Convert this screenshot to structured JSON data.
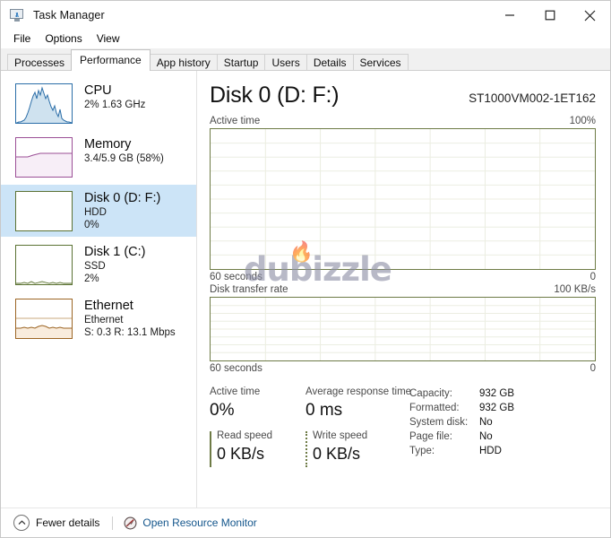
{
  "window": {
    "title": "Task Manager",
    "app_icon": "task-manager-icon",
    "controls": {
      "minimize": "minimize-icon",
      "maximize": "maximize-icon",
      "close": "close-icon"
    }
  },
  "menu": {
    "items": [
      "File",
      "Options",
      "View"
    ]
  },
  "tabs": {
    "active": "Performance",
    "items": [
      "Processes",
      "Performance",
      "App history",
      "Startup",
      "Users",
      "Details",
      "Services"
    ]
  },
  "sidebar": {
    "items": [
      {
        "name": "CPU",
        "line1": "CPU",
        "line2": "2%  1.63 GHz",
        "line3": "",
        "selected": false,
        "accent": "#2b6ea8"
      },
      {
        "name": "Memory",
        "line1": "Memory",
        "line2": "3.4/5.9 GB (58%)",
        "line3": "",
        "selected": false,
        "accent": "#9b4f96"
      },
      {
        "name": "Disk 0",
        "line1": "Disk 0 (D: F:)",
        "line2": "HDD",
        "line3": "0%",
        "selected": true,
        "accent": "#5b7233"
      },
      {
        "name": "Disk 1",
        "line1": "Disk 1 (C:)",
        "line2": "SSD",
        "line3": "2%",
        "selected": false,
        "accent": "#5b7233"
      },
      {
        "name": "Ethernet",
        "line1": "Ethernet",
        "line2": "Ethernet",
        "line3": "S: 0.3 R: 13.1 Mbps",
        "selected": false,
        "accent": "#9c6524"
      }
    ]
  },
  "main": {
    "title": "Disk 0 (D: F:)",
    "model": "ST1000VM002-1ET162",
    "active_graph": {
      "label": "Active time",
      "max": "100%",
      "x_left": "60 seconds",
      "x_right": "0"
    },
    "transfer_graph": {
      "label": "Disk transfer rate",
      "max": "100 KB/s",
      "x_left": "60 seconds",
      "x_right": "0"
    },
    "stats": {
      "active_time_label": "Active time",
      "active_time_value": "0%",
      "response_label": "Average response time",
      "response_value": "0 ms",
      "read_label": "Read speed",
      "read_value": "0 KB/s",
      "write_label": "Write speed",
      "write_value": "0 KB/s",
      "info": [
        {
          "key": "Capacity:",
          "value": "932 GB"
        },
        {
          "key": "Formatted:",
          "value": "932 GB"
        },
        {
          "key": "System disk:",
          "value": "No"
        },
        {
          "key": "Page file:",
          "value": "No"
        },
        {
          "key": "Type:",
          "value": "HDD"
        }
      ]
    }
  },
  "statusbar": {
    "fewer_details": "Fewer details",
    "fewer_details_pre": "F",
    "fewer_details_mid": "ewer ",
    "fewer_details_acc": "d",
    "fewer_details_post": "etails",
    "resource_monitor": "Open Resource Monitor",
    "resource_monitor_color": "#14568c"
  },
  "watermark": {
    "text": "dubizzle"
  },
  "chart_data": [
    {
      "type": "area",
      "title": "Active time",
      "ylabel": "",
      "xlabel": "60 seconds",
      "ylim": [
        0,
        100
      ],
      "y_max_label": "100%",
      "x_left_label": "60 seconds",
      "x_right_label": "0",
      "grid": true,
      "grid_rows": 10,
      "grid_cols": 6,
      "line_color": "#6e7b46",
      "fill_color": "#e8ebd9",
      "values": [
        0,
        0,
        0,
        0,
        0,
        0,
        0,
        0,
        0,
        0,
        0,
        0,
        0,
        0,
        0,
        0,
        0,
        0,
        0,
        0,
        0,
        0,
        0,
        0,
        0,
        0,
        0,
        0,
        0,
        0,
        0,
        0,
        0,
        0,
        0,
        0,
        0,
        0,
        0,
        0,
        0,
        0,
        0,
        0,
        0,
        0,
        0,
        0,
        0,
        0,
        0,
        0,
        0,
        0,
        0,
        0,
        0,
        0,
        0,
        0
      ]
    },
    {
      "type": "line",
      "title": "Disk transfer rate",
      "ylabel": "",
      "xlabel": "60 seconds",
      "ylim": [
        0,
        100
      ],
      "y_max_label": "100 KB/s",
      "x_left_label": "60 seconds",
      "x_right_label": "0",
      "grid": true,
      "grid_rows": 8,
      "grid_cols": 6,
      "line_color": "#6e7b46",
      "series": [
        {
          "name": "Read speed",
          "style": "solid",
          "values": [
            0,
            0,
            0,
            0,
            0,
            0,
            0,
            0,
            0,
            0,
            0,
            0,
            0,
            0,
            0,
            0,
            0,
            0,
            0,
            0,
            0,
            0,
            0,
            0,
            0,
            0,
            0,
            0,
            0,
            0,
            0,
            0,
            0,
            0,
            0,
            0,
            0,
            0,
            0,
            0,
            0,
            0,
            0,
            0,
            0,
            0,
            0,
            0,
            0,
            0,
            0,
            0,
            0,
            0,
            0,
            0,
            0,
            0,
            0,
            0
          ]
        },
        {
          "name": "Write speed",
          "style": "dotted",
          "values": [
            0,
            0,
            0,
            0,
            0,
            0,
            0,
            0,
            0,
            0,
            0,
            0,
            0,
            0,
            0,
            0,
            0,
            0,
            0,
            0,
            0,
            0,
            0,
            0,
            0,
            0,
            0,
            0,
            0,
            0,
            0,
            0,
            0,
            0,
            0,
            0,
            0,
            0,
            0,
            0,
            0,
            0,
            0,
            0,
            0,
            0,
            0,
            0,
            0,
            0,
            0,
            0,
            0,
            0,
            0,
            0,
            0,
            0,
            0,
            0
          ]
        }
      ]
    },
    {
      "type": "area",
      "title": "CPU thumbnail",
      "ylim": [
        0,
        100
      ],
      "line_color": "#2b6ea8",
      "fill_color": "#cfe2ef",
      "values": [
        2,
        2,
        3,
        2,
        4,
        3,
        5,
        8,
        14,
        26,
        38,
        52,
        64,
        58,
        70,
        62,
        78,
        66,
        54,
        62,
        48,
        36,
        28,
        34,
        22,
        16,
        30,
        14,
        9,
        6,
        5,
        4,
        3,
        3,
        2,
        2,
        2,
        2,
        2,
        2
      ]
    },
    {
      "type": "area",
      "title": "Memory thumbnail",
      "ylim": [
        0,
        100
      ],
      "line_color": "#9b4f96",
      "fill_color": "#f2e6f2",
      "values": [
        50,
        50,
        50,
        50,
        50,
        50,
        51,
        51,
        52,
        53,
        55,
        57,
        58,
        58,
        58,
        58,
        58,
        58,
        58,
        58,
        58,
        58,
        58,
        58,
        58,
        58,
        58,
        58,
        58,
        58,
        58,
        58,
        58,
        58,
        58,
        58,
        58,
        58,
        58,
        58
      ]
    },
    {
      "type": "area",
      "title": "Disk 0 thumbnail",
      "ylim": [
        0,
        100
      ],
      "line_color": "#5b7233",
      "fill_color": "#eef1e4",
      "values": [
        0,
        0,
        0,
        0,
        0,
        0,
        0,
        0,
        0,
        0,
        0,
        0,
        0,
        0,
        0,
        0,
        0,
        0,
        0,
        0,
        0,
        0,
        0,
        0,
        0,
        0,
        0,
        0,
        0,
        0,
        0,
        0,
        0,
        0,
        0,
        0,
        0,
        0,
        0,
        0
      ]
    },
    {
      "type": "area",
      "title": "Disk 1 thumbnail",
      "ylim": [
        0,
        100
      ],
      "line_color": "#5b7233",
      "fill_color": "#eef1e4",
      "values": [
        2,
        2,
        3,
        2,
        2,
        4,
        3,
        2,
        5,
        3,
        2,
        2,
        6,
        3,
        2,
        2,
        3,
        5,
        2,
        2,
        2,
        3,
        2,
        2,
        4,
        2,
        2,
        2,
        3,
        2,
        2,
        2,
        2,
        2,
        3,
        2,
        2,
        2,
        2,
        2
      ]
    },
    {
      "type": "area",
      "title": "Ethernet thumbnail",
      "ylim": [
        0,
        100
      ],
      "line_color": "#9c6524",
      "fill_color": "#f7ece0",
      "values": [
        26,
        26,
        27,
        26,
        28,
        26,
        27,
        30,
        26,
        26,
        27,
        26,
        29,
        27,
        26,
        32,
        34,
        30,
        27,
        26,
        28,
        26,
        27,
        26,
        26,
        28,
        26,
        26,
        27,
        26,
        26,
        26,
        28,
        26,
        26,
        27,
        26,
        26,
        26,
        26
      ]
    }
  ]
}
